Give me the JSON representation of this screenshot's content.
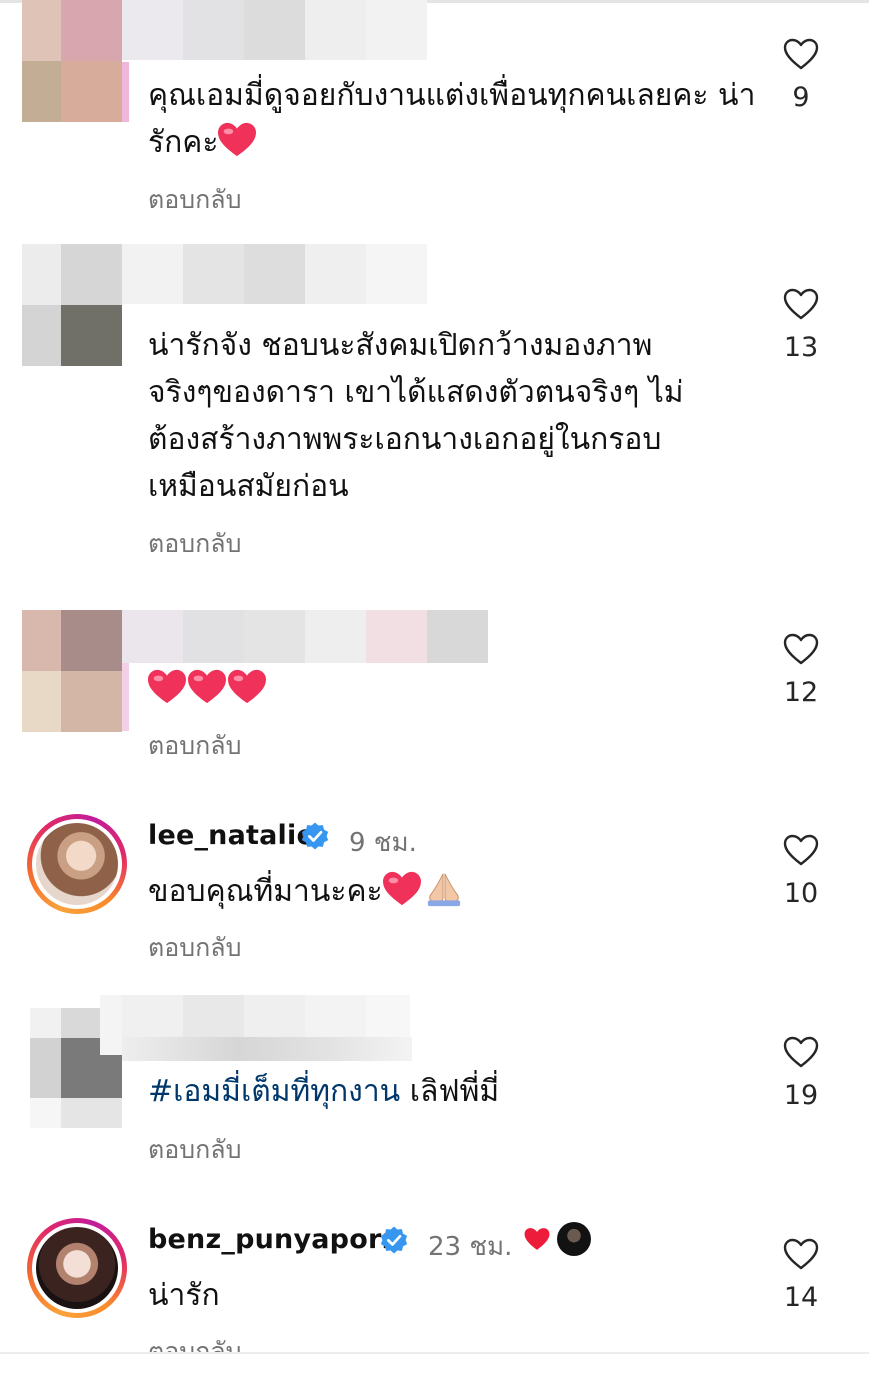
{
  "reply_label": "ตอบกลับ",
  "colors": {
    "hashtag": "#00376b",
    "muted": "#737373",
    "verified": "#3797f0",
    "heart_emoji": "#f0325a"
  },
  "comments": [
    {
      "user": "",
      "text": "คุณเอมมี่ดูจอยกับงานแต่งเพื่อนทุกคนเลยคะ น่ารักคะ",
      "text_emoji": "red-heart",
      "likes": "9"
    },
    {
      "user": "",
      "text_lines": [
        "น่ารักจัง  ชอบนะสังคมเปิดกว้างมองภาพ",
        "จริงๆของดารา เขาได้แสดงตัวตนจริงๆ ไม่",
        "ต้องสร้างภาพพระเอกนางเอกอยู่ในกรอบ",
        "เหมือนสมัยก่อน"
      ],
      "likes": "13"
    },
    {
      "user": "",
      "text_emoji": "three-red-hearts",
      "likes": "12"
    },
    {
      "user": "lee_natalie",
      "verified": true,
      "time": "9 ชม.",
      "text": "ขอบคุณที่มานะคะ",
      "text_emoji": "red-heart folded-hands",
      "likes": "10"
    },
    {
      "user": "",
      "hashtag": "#เอมมี่เต็มที่ทุกงาน",
      "text": " เลิฟพี่มี่",
      "likes": "19"
    },
    {
      "user": "benz_punyaporn",
      "verified": true,
      "time": "23 ชม.",
      "badge_emoji": "red-heart",
      "text": "น่ารัก",
      "likes": "14"
    }
  ]
}
